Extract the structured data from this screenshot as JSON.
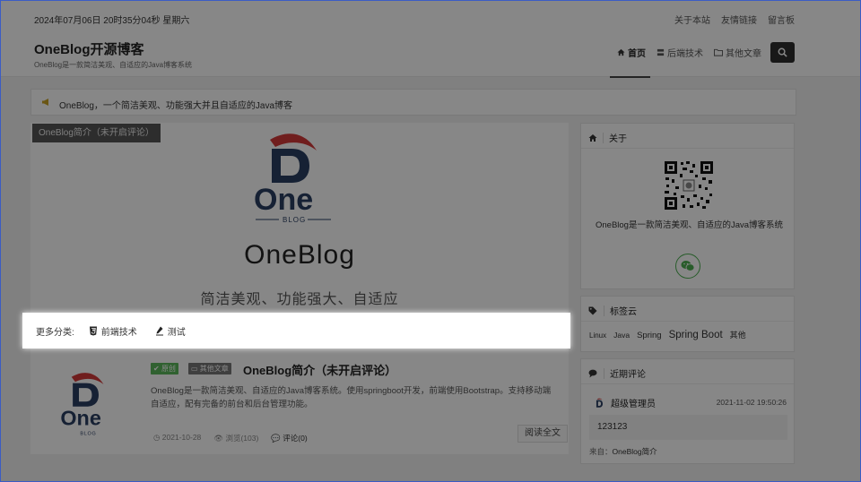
{
  "topbar": {
    "datetime": "2024年07月06日 20时35分04秒 星期六",
    "links": [
      "关于本站",
      "友情链接",
      "留言板"
    ]
  },
  "header": {
    "brand": "OneBlog开源博客",
    "tagline": "OneBlog是一款简洁美观、自适应的Java博客系统",
    "nav": [
      {
        "label": "首页",
        "icon": "home-icon"
      },
      {
        "label": "后端技术",
        "icon": "server-icon"
      },
      {
        "label": "其他文章",
        "icon": "folder-icon"
      }
    ],
    "search_icon": "search-icon"
  },
  "notice": {
    "icon": "megaphone-icon",
    "text": "OneBlog，一个简洁美观、功能强大并且自适应的Java博客"
  },
  "banner": {
    "tag": "OneBlog简介（未开启评论）",
    "logo_text": "BLOG",
    "title": "OneBlog",
    "subtitle": "简洁美观、功能强大、自适应"
  },
  "more_categories": {
    "label": "更多分类:",
    "items": [
      {
        "label": "前端技术",
        "icon": "css3-icon"
      },
      {
        "label": "测试",
        "icon": "pen-icon"
      }
    ]
  },
  "article": {
    "badges": [
      "原创",
      "其他文章"
    ],
    "title": "OneBlog简介（未开启评论）",
    "description": "OneBlog是一款简洁美观、自适应的Java博客系统。使用springboot开发，前端使用Bootstrap。支持移动端自适应，配有完备的前台和后台管理功能。",
    "date": "2021-10-28",
    "views": "浏览(103)",
    "comments": "评论(0)",
    "read_more": "阅读全文"
  },
  "sidebar": {
    "about": {
      "title": "关于",
      "text": "OneBlog是一款简洁美观、自适应的Java博客系统"
    },
    "tags": {
      "title": "标签云",
      "items": [
        "Linux",
        "Java",
        "Spring",
        "Spring Boot",
        "其他"
      ]
    },
    "recent_comments": {
      "title": "近期评论",
      "user": "超级管理员",
      "time": "2021-11-02 19:50:26",
      "content": "123123",
      "source_label": "来自：",
      "source": "OneBlog简介"
    }
  },
  "colors": {
    "logo_blue": "#2b3f63",
    "logo_red": "#d33a3a",
    "wechat_green": "#4caf50",
    "overlay": "rgba(0,0,0,0.47)"
  }
}
